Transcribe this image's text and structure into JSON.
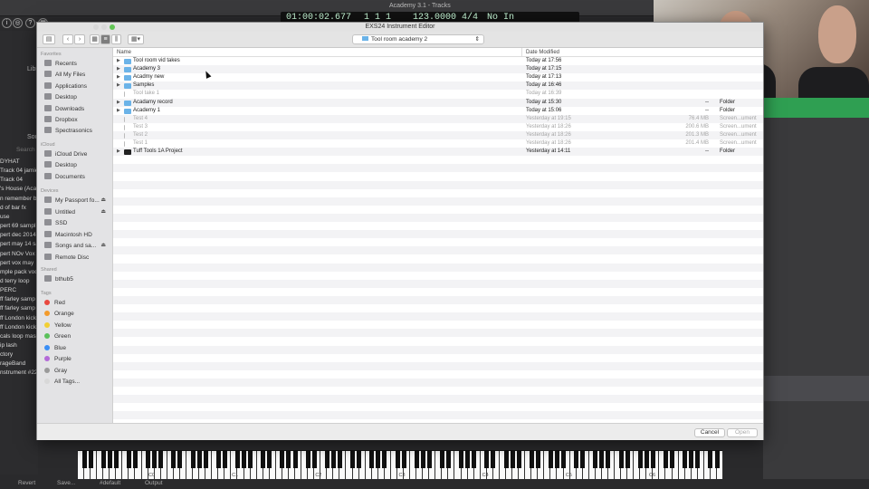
{
  "host": {
    "window_title": "Academy 3.1 - Tracks",
    "lcd": {
      "time": "01:00:02.677",
      "bar": "1 1 1",
      "tempo": "123.0000",
      "signature": "4/4",
      "key": "No In"
    },
    "library_label": "Libr",
    "sound_label": "Sou",
    "search_placeholder": "Search",
    "left_items": [
      "DYHAT",
      "Track 04 jamie",
      "Track 04",
      "'s House (Aca",
      "n remember b",
      "d of bar fx",
      "use",
      "pert 69 sampl",
      "pert dec 2014",
      "pert may 14 sa",
      "pert NOv Vox",
      "pert vox may",
      "mple pack voc",
      "d terry loop",
      "PERC",
      "ff farley samp",
      "ff farley samp",
      "ff London kick",
      "ff London kick",
      "cals  loop mas",
      "ip lash",
      "ctory",
      "rageBand",
      "nstrument #222"
    ],
    "piano_octaves": [
      "C0",
      "C1",
      "C2",
      "C3",
      "C4",
      "C5",
      "C6"
    ],
    "bottom_bar": {
      "revert": "Revert",
      "save": "Save...",
      "default": "#default",
      "output": "Output"
    }
  },
  "dialog": {
    "title": "EXS24 Instrument Editor",
    "location": "Tool room academy 2",
    "columns": {
      "name": "Name",
      "date": "Date Modified"
    },
    "sidebar": {
      "favorites_heading": "Favorites",
      "favorites": [
        "Recents",
        "All My Files",
        "Applications",
        "Desktop",
        "Downloads",
        "Dropbox",
        "Spectrasonics"
      ],
      "icloud_heading": "iCloud",
      "icloud": [
        "iCloud Drive",
        "Desktop",
        "Documents"
      ],
      "devices_heading": "Devices",
      "devices": [
        {
          "label": "My Passport fo...",
          "eject": "⏏"
        },
        {
          "label": "Untitled",
          "eject": "⏏"
        },
        {
          "label": "SSD",
          "eject": ""
        },
        {
          "label": "Macintosh HD",
          "eject": ""
        },
        {
          "label": "Songs and sa...",
          "eject": "⏏"
        },
        {
          "label": "Remote Disc",
          "eject": ""
        }
      ],
      "shared_heading": "Shared",
      "shared": [
        "bthub5"
      ],
      "tags_heading": "Tags",
      "tags": [
        {
          "label": "Red",
          "color": "#e8483f"
        },
        {
          "label": "Orange",
          "color": "#f39a2a"
        },
        {
          "label": "Yellow",
          "color": "#f2cf33"
        },
        {
          "label": "Green",
          "color": "#5ac05a"
        },
        {
          "label": "Blue",
          "color": "#3a8ef5"
        },
        {
          "label": "Purple",
          "color": "#b46ad8"
        },
        {
          "label": "Gray",
          "color": "#9a9a9a"
        },
        {
          "label": "All Tags...",
          "color": "#d8d8d8"
        }
      ]
    },
    "files": [
      {
        "name": "Tool room vid takes",
        "date": "Today at 17:56",
        "size": "",
        "kind": "",
        "type": "folder",
        "expandable": true,
        "dim": false
      },
      {
        "name": "Academy 3",
        "date": "Today at 17:15",
        "size": "",
        "kind": "",
        "type": "folder",
        "expandable": true,
        "dim": false
      },
      {
        "name": "Acadmy new",
        "date": "Today at 17:13",
        "size": "",
        "kind": "",
        "type": "folder",
        "expandable": true,
        "dim": false
      },
      {
        "name": "Samples",
        "date": "Today at 16:46",
        "size": "",
        "kind": "",
        "type": "folder",
        "expandable": true,
        "dim": false
      },
      {
        "name": "Tool take 1",
        "date": "Today at 16:39",
        "size": "",
        "kind": "",
        "type": "file",
        "expandable": false,
        "dim": true
      },
      {
        "name": "Acadamy record",
        "date": "Today at 15:30",
        "size": "--",
        "kind": "Folder",
        "type": "folder",
        "expandable": true,
        "dim": false
      },
      {
        "name": "Academy 1",
        "date": "Today at 15:06",
        "size": "--",
        "kind": "Folder",
        "type": "folder",
        "expandable": true,
        "dim": false
      },
      {
        "name": "Test 4",
        "date": "Yesterday at 19:15",
        "size": "76.4 MB",
        "kind": "Screen...ument",
        "type": "file",
        "expandable": false,
        "dim": true
      },
      {
        "name": "Test 3",
        "date": "Yesterday at 18:26",
        "size": "200.6 MB",
        "kind": "Screen...ument",
        "type": "file",
        "expandable": false,
        "dim": true
      },
      {
        "name": "Test 2",
        "date": "Yesterday at 18:26",
        "size": "201.3 MB",
        "kind": "Screen...ument",
        "type": "file",
        "expandable": false,
        "dim": true
      },
      {
        "name": "Test 1",
        "date": "Yesterday at 18:26",
        "size": "201.4 MB",
        "kind": "Screen...ument",
        "type": "file",
        "expandable": false,
        "dim": true
      },
      {
        "name": "Tuff Tools 1A Project",
        "date": "Yesterday at 14:11",
        "size": "--",
        "kind": "Folder",
        "type": "project",
        "expandable": true,
        "dim": false
      }
    ],
    "cancel_label": "Cancel",
    "open_label": "Open"
  },
  "colors": {
    "folder_blue": "#6bb3e8",
    "accent_green": "#2f9f52"
  }
}
